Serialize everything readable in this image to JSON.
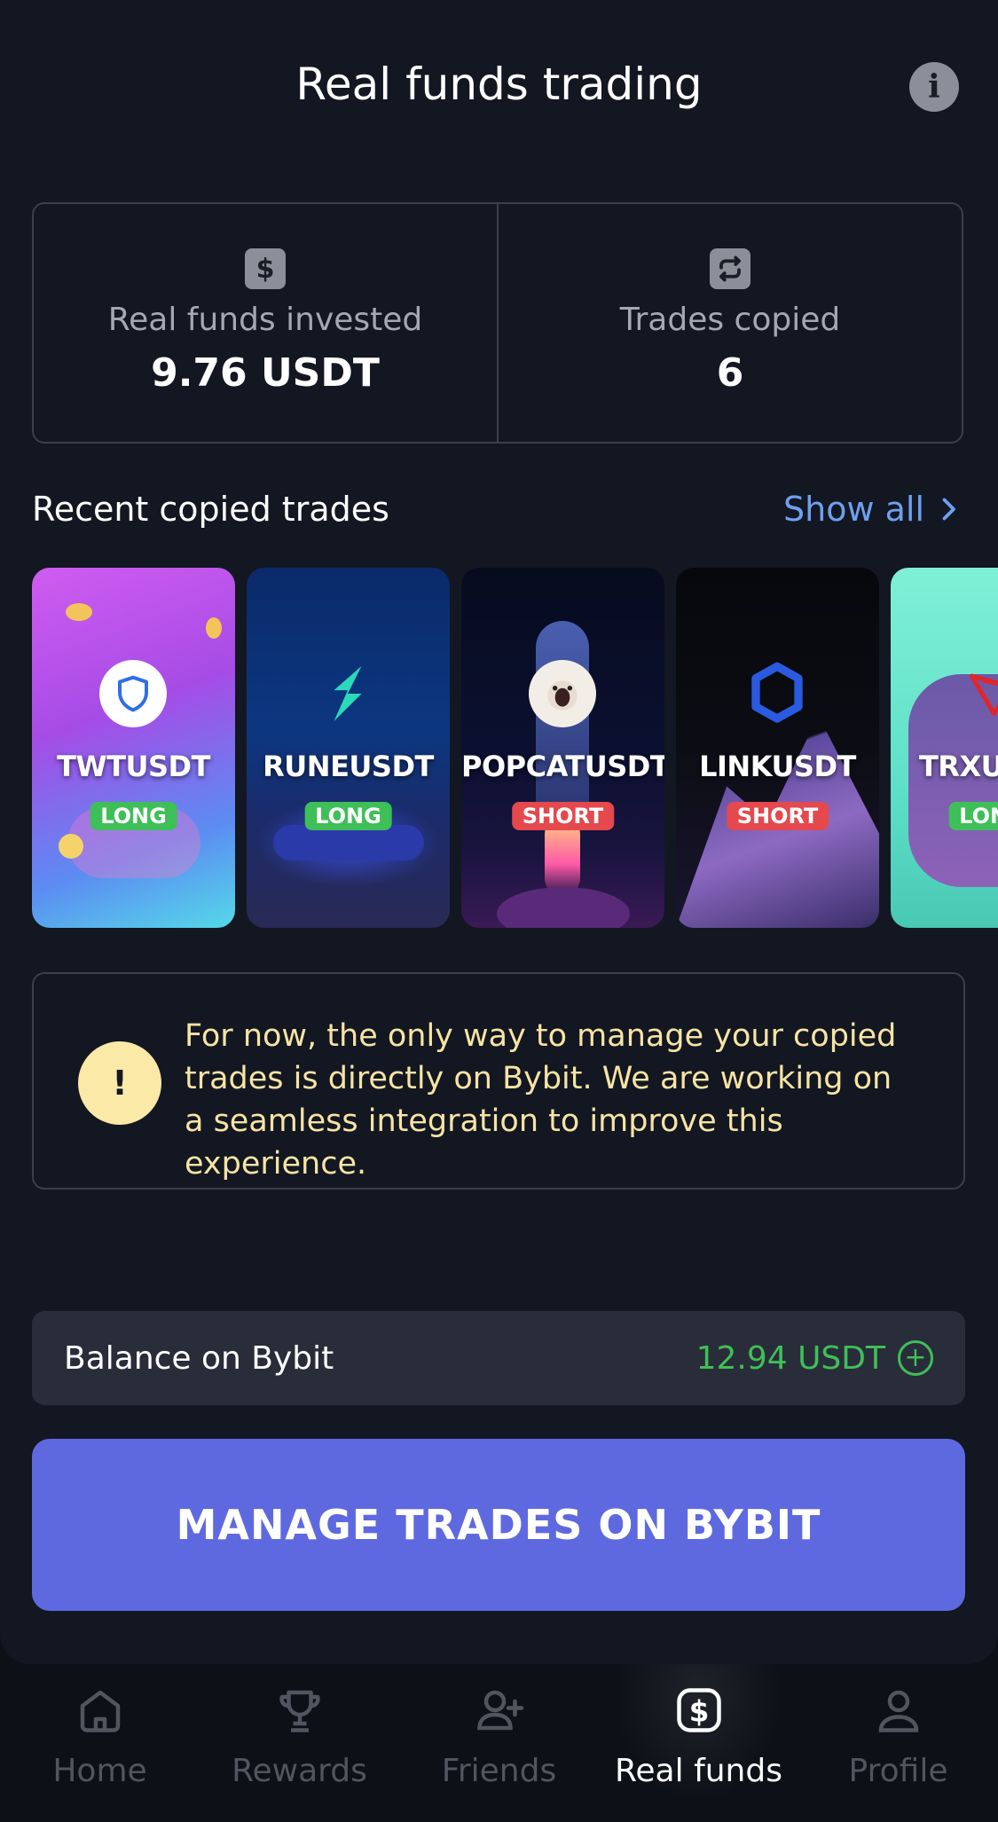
{
  "header": {
    "title": "Real funds trading",
    "info_icon": "info-icon"
  },
  "stats": [
    {
      "icon": "dollar-icon",
      "label": "Real funds invested",
      "value": "9.76 USDT"
    },
    {
      "icon": "repeat-icon",
      "label": "Trades copied",
      "value": "6"
    }
  ],
  "recent": {
    "title": "Recent copied trades",
    "show_all": "Show all",
    "trades": [
      {
        "symbol": "TWTUSDT",
        "side": "LONG"
      },
      {
        "symbol": "RUNEUSDT",
        "side": "LONG"
      },
      {
        "symbol": "POPCATUSDT",
        "side": "SHORT"
      },
      {
        "symbol": "LINKUSDT",
        "side": "SHORT"
      },
      {
        "symbol": "TRXUSDT",
        "side": "LONG"
      }
    ]
  },
  "notice": {
    "icon": "exclamation-icon",
    "text": "For now, the only way to manage your copied trades is directly on Bybit. We are working on a seamless integration to improve this experience."
  },
  "balance": {
    "label": "Balance on Bybit",
    "value": "12.94 USDT"
  },
  "cta": {
    "label": "MANAGE TRADES ON BYBIT",
    "color": "#5e69e0"
  },
  "nav": {
    "items": [
      {
        "label": "Home",
        "icon": "home-icon",
        "active": false
      },
      {
        "label": "Rewards",
        "icon": "trophy-icon",
        "active": false
      },
      {
        "label": "Friends",
        "icon": "add-user-icon",
        "active": false
      },
      {
        "label": "Real funds",
        "icon": "dollar-icon",
        "active": true
      },
      {
        "label": "Profile",
        "icon": "user-icon",
        "active": false
      }
    ]
  },
  "colors": {
    "background": "#131722",
    "accent_green": "#3fbf57",
    "accent_red": "#e5484d",
    "link_blue": "#6ea0f0",
    "notice_yellow": "#f7e4a4"
  }
}
